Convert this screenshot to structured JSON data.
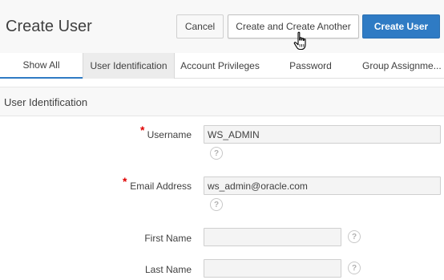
{
  "page": {
    "title": "Create User"
  },
  "toolbar": {
    "cancel_label": "Cancel",
    "create_another_label": "Create and Create Another",
    "create_label": "Create User",
    "create_color": "#2f7bc4"
  },
  "tabs": [
    {
      "label": "Show All",
      "selected": true
    },
    {
      "label": "User Identification",
      "selected": false
    },
    {
      "label": "Account Privileges",
      "selected": false
    },
    {
      "label": "Password",
      "selected": false
    },
    {
      "label": "Group Assignme..."
    }
  ],
  "region": {
    "title": "User Identification"
  },
  "form": {
    "username": {
      "label": "Username",
      "value": "WS_ADMIN",
      "required": true
    },
    "email": {
      "label": "Email Address",
      "value": "ws_admin@oracle.com",
      "required": true
    },
    "first_name": {
      "label": "First Name",
      "value": ""
    },
    "last_name": {
      "label": "Last Name",
      "value": ""
    },
    "required_marker": "*",
    "help_glyph": "?"
  },
  "icons": {
    "cursor": "hand-pointer-icon",
    "help": "help-icon"
  }
}
